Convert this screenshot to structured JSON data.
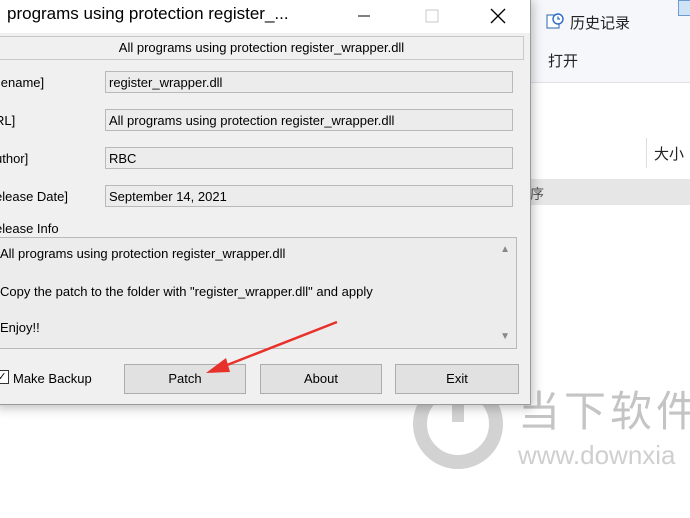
{
  "explorer": {
    "history_label": "历史记录",
    "open_label": "打开",
    "size_column": "大小",
    "sort_fragment": "序"
  },
  "watermark": {
    "text": "当下软件",
    "url": "www.downxia"
  },
  "dialog": {
    "title": "programs using protection register_...",
    "header": "All programs using protection register_wrapper.dll",
    "fields": [
      {
        "label": "ilename]",
        "value": "register_wrapper.dll"
      },
      {
        "label": "RL]",
        "value": "All programs using protection register_wrapper.dll"
      },
      {
        "label": "uthor]",
        "value": "RBC"
      },
      {
        "label": "elease Date]",
        "value": "September 14, 2021"
      }
    ],
    "release_info_label": "elease Info",
    "release_info_lines": [
      "All programs using protection register_wrapper.dll",
      "Copy the patch to the folder with \"register_wrapper.dll\" and apply",
      "Enjoy!!"
    ],
    "backup_label": "Make Backup",
    "backup_checked": true,
    "buttons": {
      "patch": "Patch",
      "about": "About",
      "exit": "Exit"
    }
  },
  "annotation_color": "#e8312a"
}
